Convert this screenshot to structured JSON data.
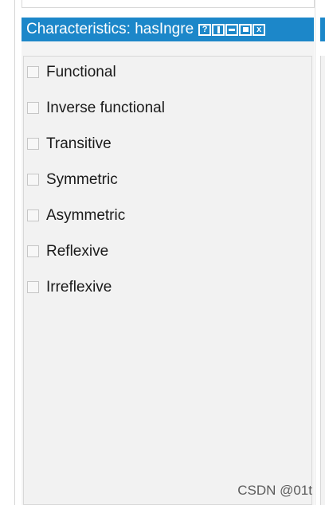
{
  "view": {
    "title": "Characteristics: hasIngre",
    "buttons": [
      {
        "name": "help",
        "glyph": "?"
      },
      {
        "name": "split"
      },
      {
        "name": "minimize"
      },
      {
        "name": "maximize"
      },
      {
        "name": "close",
        "glyph": "x"
      }
    ]
  },
  "characteristics": [
    {
      "label": "Functional",
      "checked": false
    },
    {
      "label": "Inverse functional",
      "checked": false
    },
    {
      "label": "Transitive",
      "checked": false
    },
    {
      "label": "Symmetric",
      "checked": false
    },
    {
      "label": "Asymmetric",
      "checked": false
    },
    {
      "label": "Reflexive",
      "checked": false
    },
    {
      "label": "Irreflexive",
      "checked": false
    }
  ],
  "watermark": "CSDN @01t",
  "colors": {
    "title_bar": "#1c87c9",
    "panel_bg": "#f2f2f2"
  }
}
